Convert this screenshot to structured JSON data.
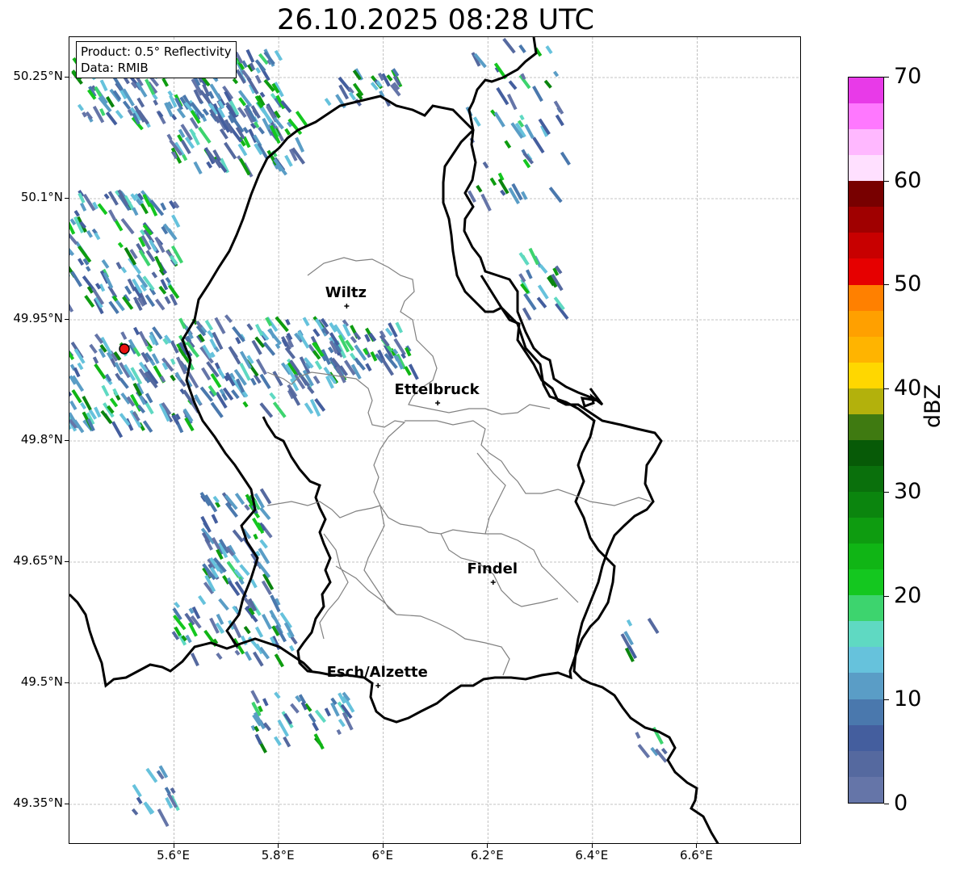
{
  "title": "26.10.2025 08:28 UTC",
  "info": {
    "product": "Product: 0.5° Reflectivity",
    "data": "Data: RMIB"
  },
  "map": {
    "lon_range": [
      5.4,
      6.8
    ],
    "lat_range": [
      49.3,
      50.3
    ],
    "lon_ticks": [
      "5.6°E",
      "5.8°E",
      "6°E",
      "6.2°E",
      "6.4°E",
      "6.6°E"
    ],
    "lat_ticks": [
      "50.25°N",
      "50.1°N",
      "49.95°N",
      "49.8°N",
      "49.65°N",
      "49.5°N",
      "49.35°N"
    ],
    "grid": true,
    "radar_site": {
      "lon": 5.505,
      "lat": 49.914,
      "color": "#e8140f"
    },
    "cities": [
      {
        "name": "Wiltz",
        "lon": 5.93,
        "lat": 49.967
      },
      {
        "name": "Ettelbruck",
        "lon": 6.104,
        "lat": 49.847
      },
      {
        "name": "Findel",
        "lon": 6.21,
        "lat": 49.625
      },
      {
        "name": "Esch/Alzette",
        "lon": 5.99,
        "lat": 49.497
      }
    ]
  },
  "colorbar": {
    "label": "dBZ",
    "ticks": [
      "0",
      "10",
      "20",
      "30",
      "40",
      "50",
      "60",
      "70"
    ],
    "range": [
      0,
      70
    ],
    "colors": [
      "#6575a8",
      "#55699f",
      "#445e9e",
      "#4a78ad",
      "#5a9dc6",
      "#66c2dc",
      "#5fd9c2",
      "#3dd46e",
      "#14c71f",
      "#10b515",
      "#0e9c10",
      "#0b850e",
      "#0a700c",
      "#075a07",
      "#3f7a11",
      "#b3b10c",
      "#ffd700",
      "#ffb400",
      "#ffa000",
      "#ff8000",
      "#e60000",
      "#c80000",
      "#a00000",
      "#780000",
      "#ffe0ff",
      "#ffb8ff",
      "#ff78ff",
      "#e83ae8"
    ]
  }
}
